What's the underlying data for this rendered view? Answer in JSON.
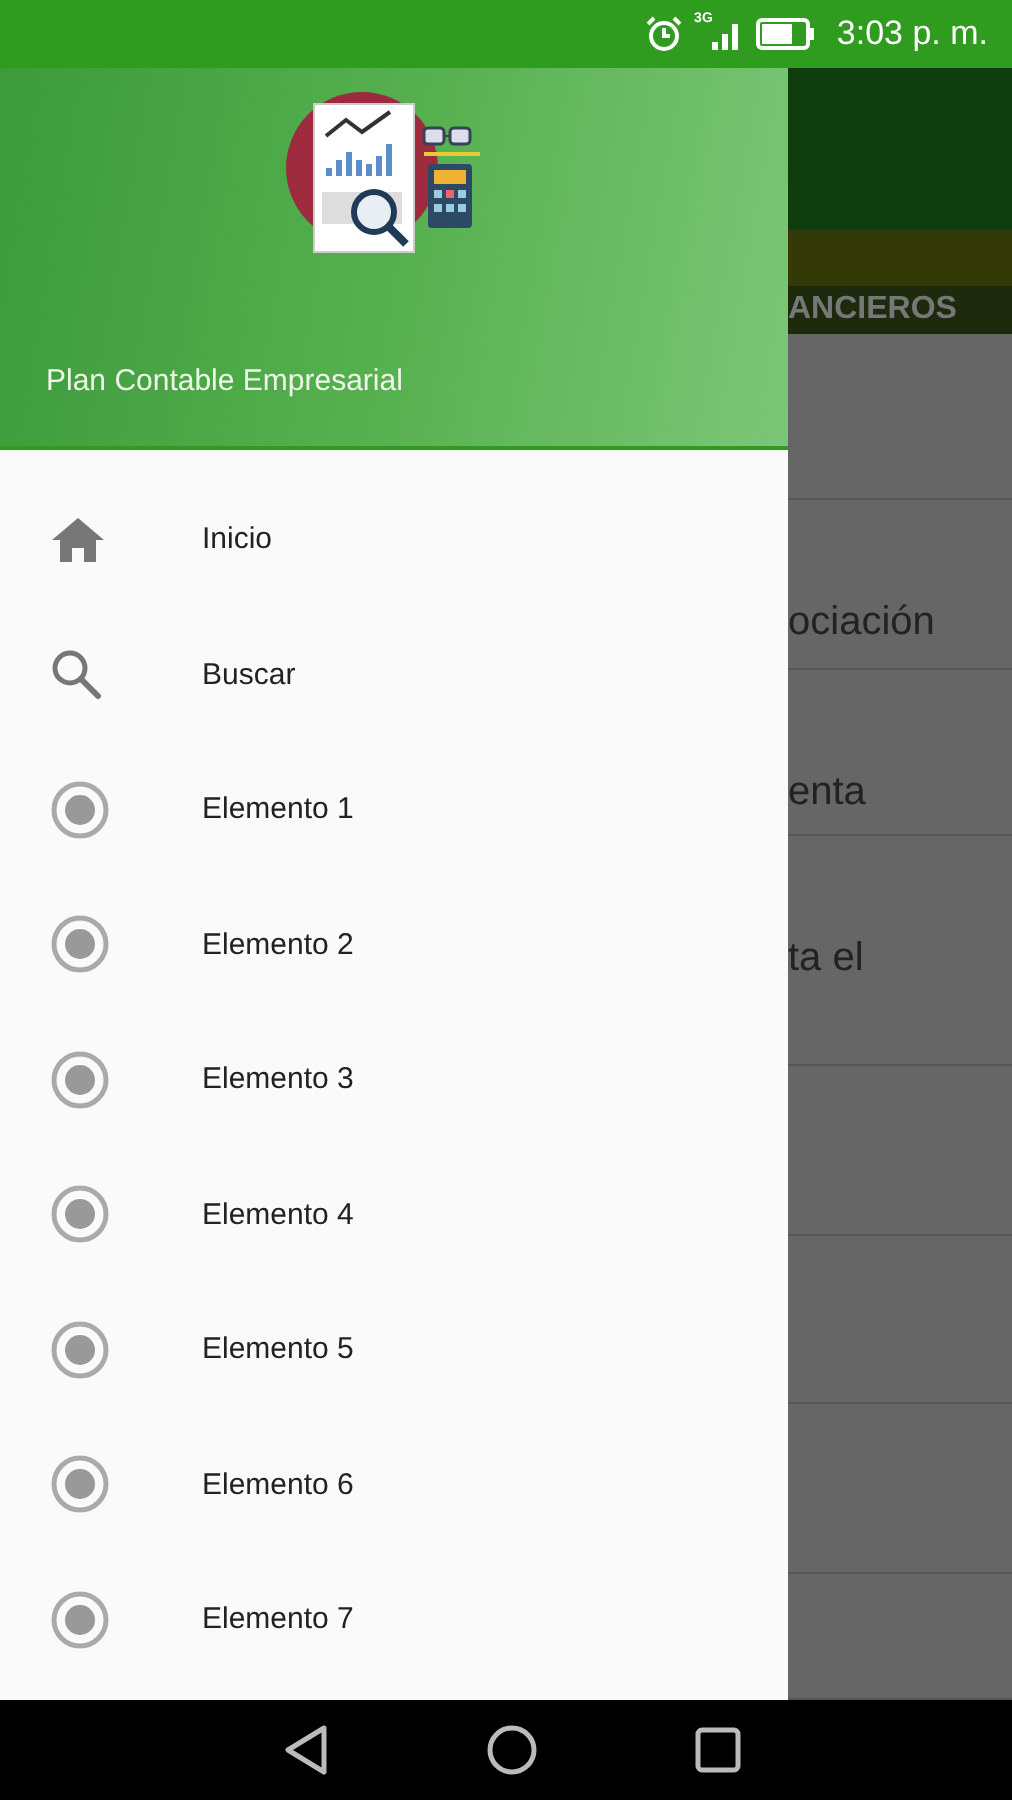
{
  "status_bar": {
    "time": "3:03 p. m.",
    "network": "3G"
  },
  "drawer": {
    "title": "Plan Contable Empresarial",
    "items": [
      {
        "kind": "home",
        "label": "Inicio"
      },
      {
        "kind": "search",
        "label": "Buscar"
      },
      {
        "kind": "radio",
        "label": "Elemento 1"
      },
      {
        "kind": "radio",
        "label": "Elemento 2"
      },
      {
        "kind": "radio",
        "label": "Elemento 3"
      },
      {
        "kind": "radio",
        "label": "Elemento 4"
      },
      {
        "kind": "radio",
        "label": "Elemento 5"
      },
      {
        "kind": "radio",
        "label": "Elemento 6"
      },
      {
        "kind": "radio",
        "label": "Elemento 7"
      }
    ]
  },
  "background_screen": {
    "tab": "ANCIEROS",
    "rows": [
      {
        "text": null
      },
      {
        "text": "ociación"
      },
      {
        "text": "enta"
      },
      {
        "text": "ta el"
      },
      {
        "text": null
      },
      {
        "text": null
      },
      {
        "text": null
      },
      {
        "text": null
      }
    ]
  }
}
